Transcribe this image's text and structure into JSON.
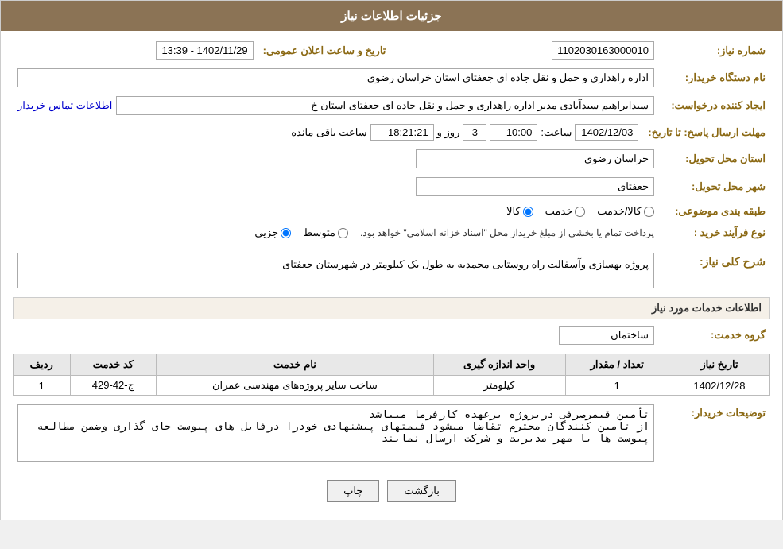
{
  "header": {
    "title": "جزئیات اطلاعات نیاز"
  },
  "fields": {
    "need_number_label": "شماره نیاز:",
    "need_number_value": "1102030163000010",
    "announce_datetime_label": "تاریخ و ساعت اعلان عمومی:",
    "announce_datetime_value": "1402/11/29 - 13:39",
    "buyer_org_label": "نام دستگاه خریدار:",
    "buyer_org_value": "اداره راهداری و حمل و نقل جاده ای جعفتای استان خراسان رضوی",
    "requester_label": "ایجاد کننده درخواست:",
    "requester_value": "سیدابراهیم سیدآبادی مدیر اداره راهداری و حمل و نقل جاده ای جعفتای استان خ",
    "requester_link": "اطلاعات تماس خریدار",
    "response_deadline_label": "مهلت ارسال پاسخ: تا تاریخ:",
    "response_date_value": "1402/12/03",
    "response_time_label": "ساعت:",
    "response_time_value": "10:00",
    "response_days_label": "روز و",
    "response_days_value": "3",
    "response_remaining_label": "ساعت باقی مانده",
    "response_remaining_value": "18:21:21",
    "delivery_province_label": "استان محل تحویل:",
    "delivery_province_value": "خراسان رضوی",
    "delivery_city_label": "شهر محل تحویل:",
    "delivery_city_value": "جعفتای",
    "classification_label": "طبقه بندی موضوعی:",
    "classification_kala": "کالا",
    "classification_khadamat": "خدمت",
    "classification_kala_khadamat": "کالا/خدمت",
    "purchase_type_label": "نوع فرآیند خرید :",
    "purchase_jozii": "جزیی",
    "purchase_motavasset": "متوسط",
    "purchase_note": "پرداخت تمام یا بخشی از مبلغ خریداز محل \"اسناد خزانه اسلامی\" خواهد بود.",
    "need_description_label": "شرح کلی نیاز:",
    "need_description_value": "پروژه بهسازی وآسفالت راه روستایی محمدیه به طول یک کیلومتر در شهرستان جعفتای",
    "services_info_label": "اطلاعات خدمات مورد نیاز",
    "service_group_label": "گروه خدمت:",
    "service_group_value": "ساختمان",
    "table": {
      "col_row": "ردیف",
      "col_code": "کد خدمت",
      "col_name": "نام خدمت",
      "col_unit": "واحد اندازه گیری",
      "col_count": "تعداد / مقدار",
      "col_date": "تاریخ نیاز",
      "rows": [
        {
          "row": "1",
          "code": "ج-42-429",
          "name": "ساخت سایر پروژه‌های مهندسی عمران",
          "unit": "کیلومتر",
          "count": "1",
          "date": "1402/12/28"
        }
      ]
    },
    "buyer_desc_label": "توضیحات خریدار:",
    "buyer_desc_value": "تأمین قیمرصرفی دربروژه برعهده کارفرما میباشد\nاز تامین کنندگان محترم تقاضا میشود فیمتهای پیشنهادی خودرا درفایل های پیوست جای گذاری وضمن مطالعه پیوست ها با مهر مدیریت و شرکت ارسال نمایند"
  },
  "buttons": {
    "print_label": "چاپ",
    "back_label": "بازگشت"
  }
}
